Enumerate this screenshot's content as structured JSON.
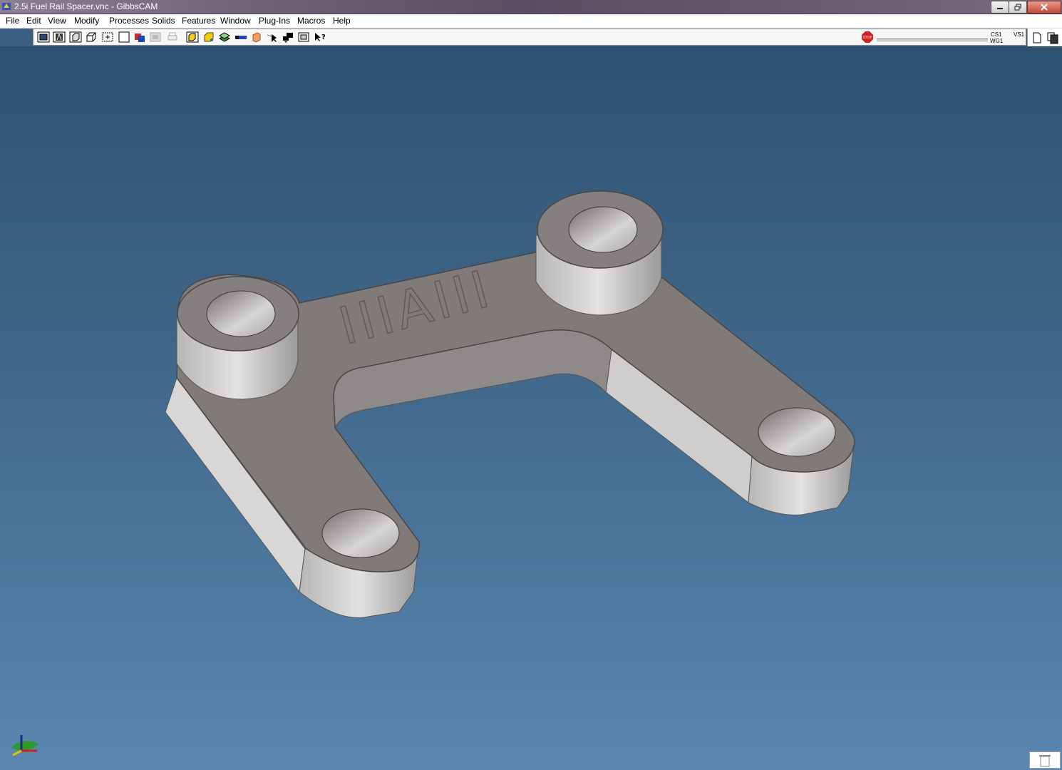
{
  "window": {
    "title": "2.5i Fuel Rail Spacer.vnc - GibbsCAM",
    "app_icon": "gibbscam-app-icon"
  },
  "menu": {
    "items": [
      "File",
      "Edit",
      "View",
      "Modify",
      "Processes",
      "Solids",
      "Features",
      "Window",
      "Plug-Ins",
      "Macros",
      "Help"
    ]
  },
  "toolbar": {
    "icons": [
      "render-wireframe-icon",
      "render-text-icon",
      "render-shaded-box-icon",
      "render-cube-icon",
      "select-point-icon",
      "blank-box-icon",
      "color-picker-icon",
      "disabled-dialog-icon",
      "print-icon",
      "solid-highlight-icon",
      "cube-yellow-icon",
      "stack-icon",
      "toolpath-icon",
      "layers-icon",
      "cursor-arrow-icon",
      "black-shape-icon",
      "view-box-icon",
      "help-cursor-icon"
    ]
  },
  "status": {
    "stop_icon": "stop-sign-icon",
    "cs_label": "CS1",
    "wg_label": "WG1",
    "vs_label": "VS1"
  },
  "palette": {
    "icons": [
      "new-document-icon",
      "copy-pages-icon",
      "rectangle-select-icon",
      "axis-red-icon",
      "solid-shape-icon",
      "axis-small-icon",
      "flange-icon",
      "plane-blue-icon",
      "eye-icon",
      "box-outline-icon",
      "eraser-icon",
      "dialog-shaded-icon",
      "disabled-rotate-icon",
      "red-bracket-icon",
      "disabled-bracket-icon",
      "disabled-copy-icon"
    ]
  },
  "viewport": {
    "engraving": "IIIAIII",
    "part_color": "#807a79",
    "wall_color": "#c9c7c6",
    "background_top": "#2f5272",
    "background_bottom": "#5a87b0"
  },
  "colors": {
    "title_bar": "#6f6275",
    "close_button": "#c44b35",
    "stop_red": "#d31f1f"
  }
}
